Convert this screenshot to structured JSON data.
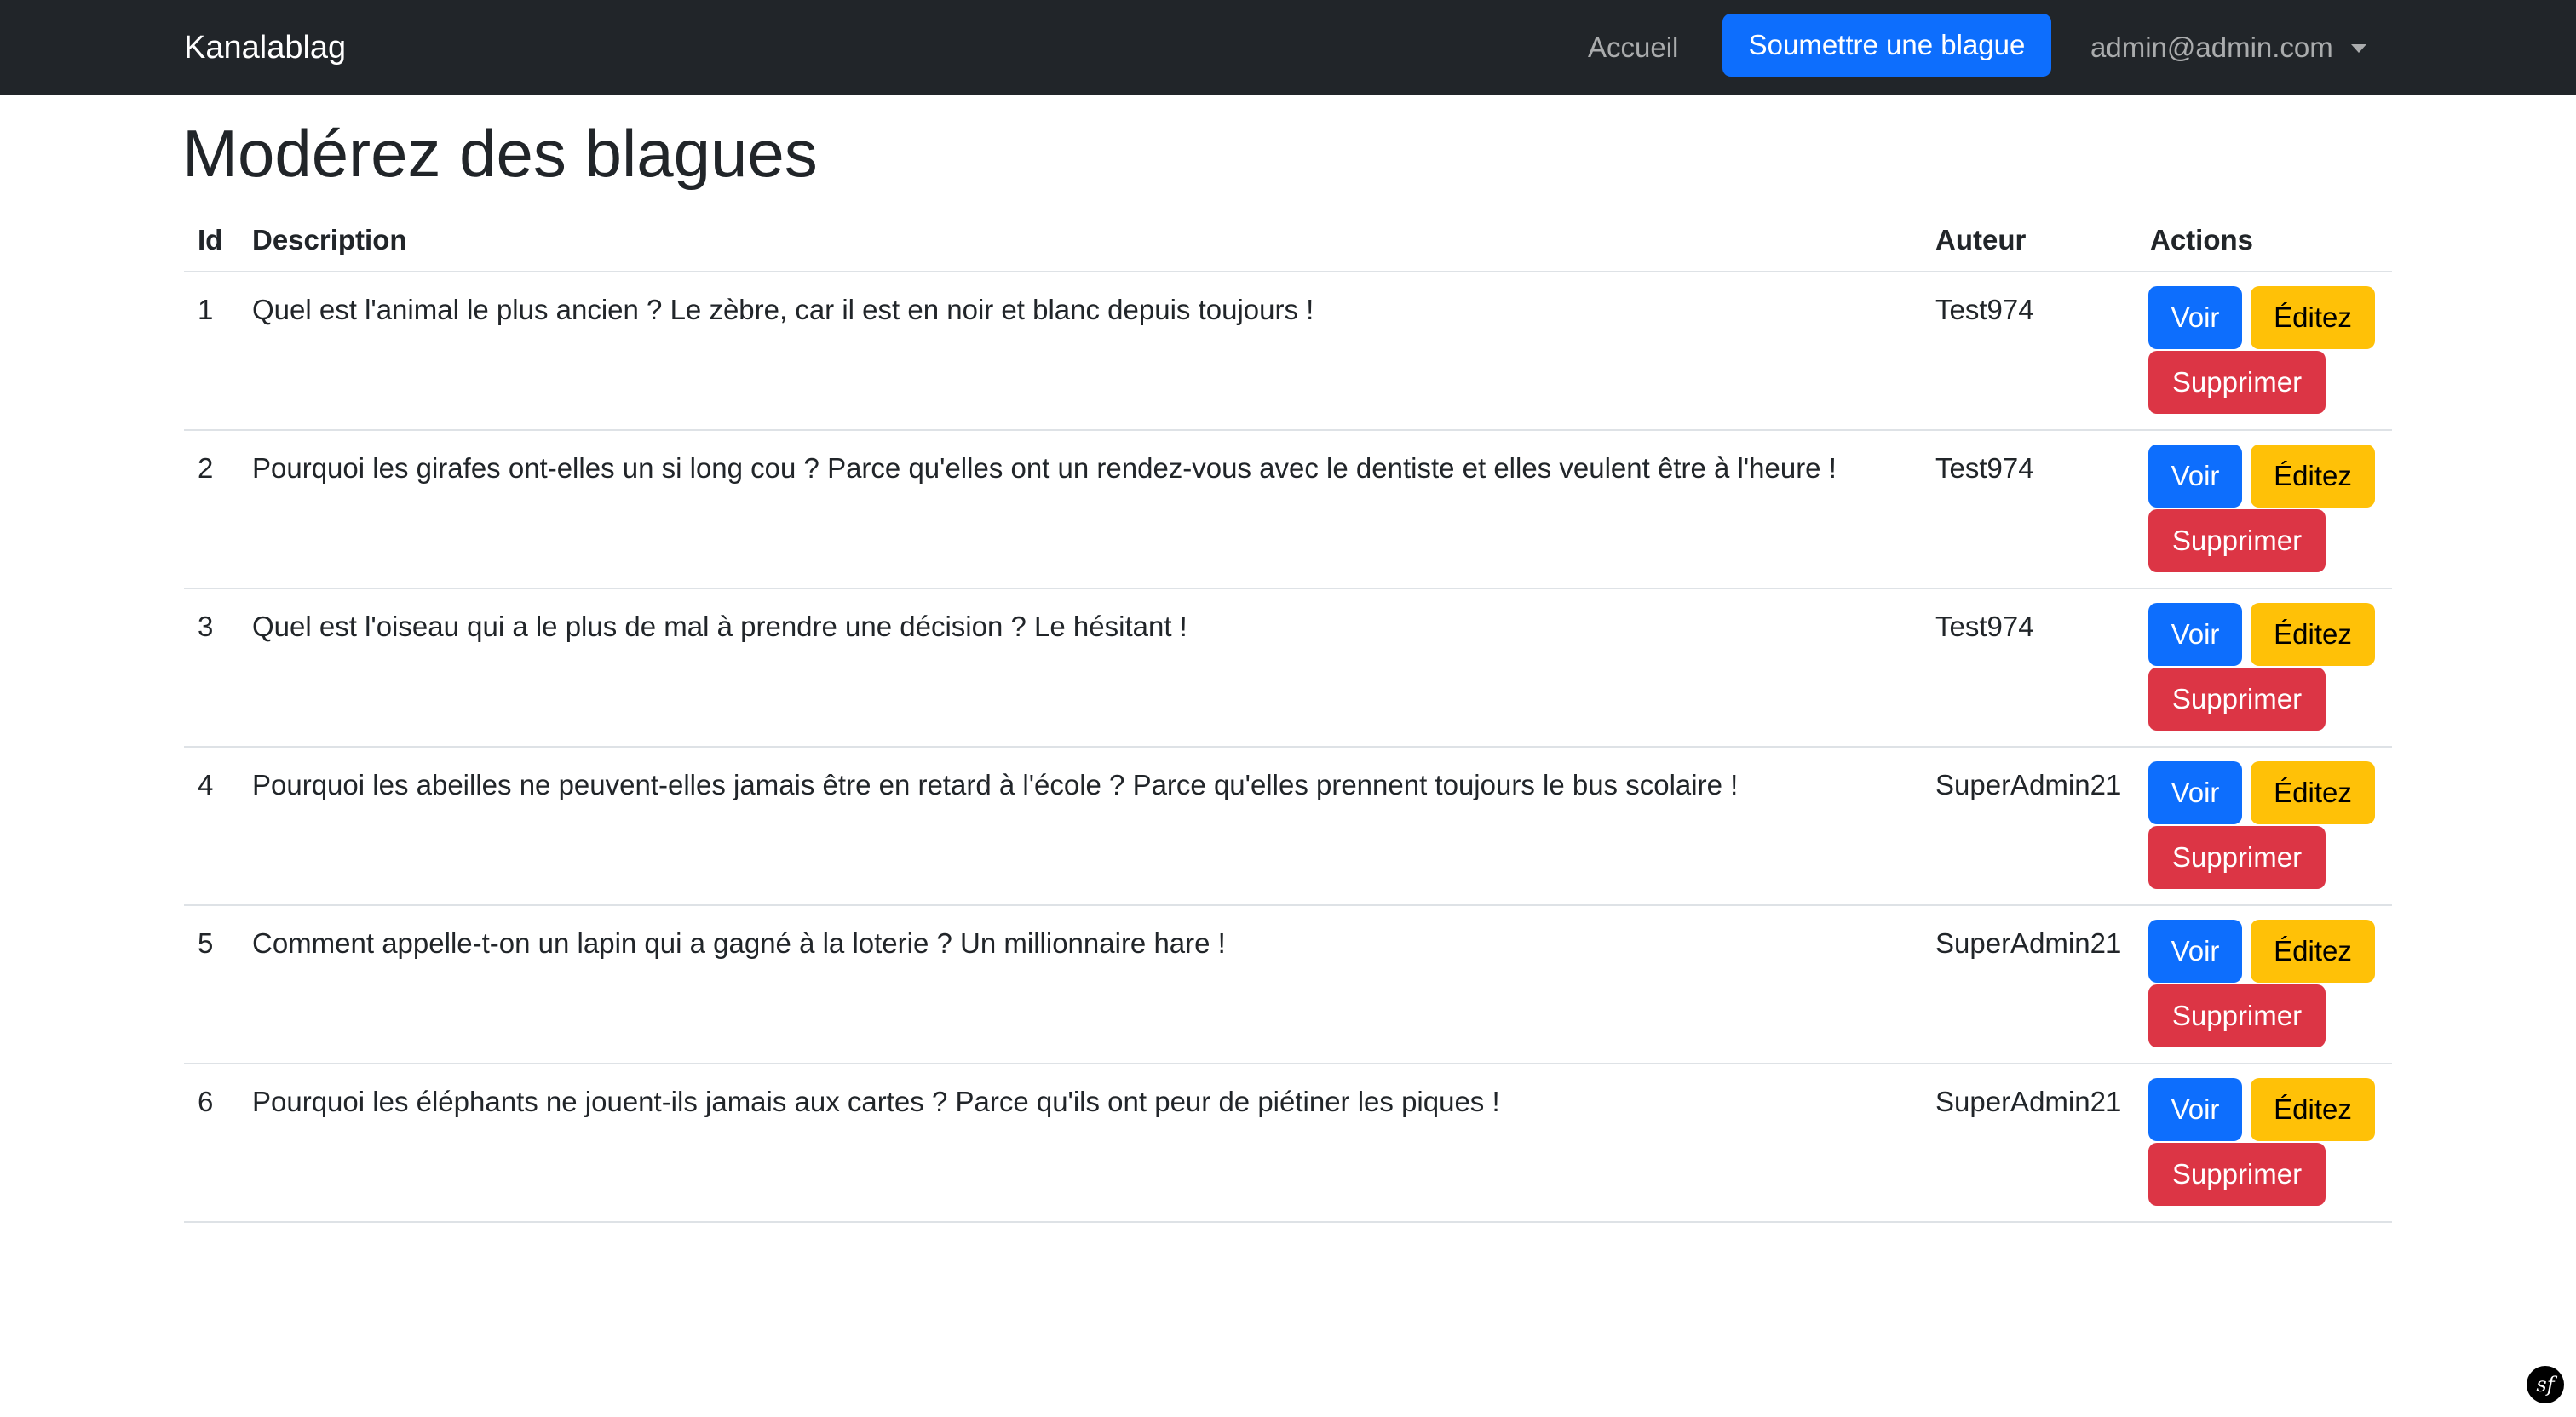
{
  "navbar": {
    "brand": "Kanalablag",
    "home_label": "Accueil",
    "submit_label": "Soumettre une blague",
    "user_label": "admin@admin.com",
    "bg_color": "#212529",
    "accent_color": "#0d6efd"
  },
  "page": {
    "title": "Modérez des blagues"
  },
  "table": {
    "headers": {
      "id": "Id",
      "description": "Description",
      "author": "Auteur",
      "actions": "Actions"
    },
    "buttons": {
      "view": "Voir",
      "edit": "Éditez",
      "delete": "Supprimer"
    },
    "rows": [
      {
        "id": "1",
        "description": "Quel est l'animal le plus ancien ? Le zèbre, car il est en noir et blanc depuis toujours !",
        "author": "Test974"
      },
      {
        "id": "2",
        "description": "Pourquoi les girafes ont-elles un si long cou ? Parce qu'elles ont un rendez-vous avec le dentiste et elles veulent être à l'heure !",
        "author": "Test974"
      },
      {
        "id": "3",
        "description": "Quel est l'oiseau qui a le plus de mal à prendre une décision ? Le hésitant !",
        "author": "Test974"
      },
      {
        "id": "4",
        "description": "Pourquoi les abeilles ne peuvent-elles jamais être en retard à l'école ? Parce qu'elles prennent toujours le bus scolaire !",
        "author": "SuperAdmin21"
      },
      {
        "id": "5",
        "description": "Comment appelle-t-on un lapin qui a gagné à la loterie ? Un millionnaire hare !",
        "author": "SuperAdmin21"
      },
      {
        "id": "6",
        "description": "Pourquoi les éléphants ne jouent-ils jamais aux cartes ? Parce qu'ils ont peur de piétiner les piques !",
        "author": "SuperAdmin21"
      }
    ],
    "colors": {
      "view": "#0d6efd",
      "edit": "#ffc107",
      "delete": "#dc3545"
    }
  },
  "footer": {
    "symfony_icon": "symfony-logo-icon"
  }
}
